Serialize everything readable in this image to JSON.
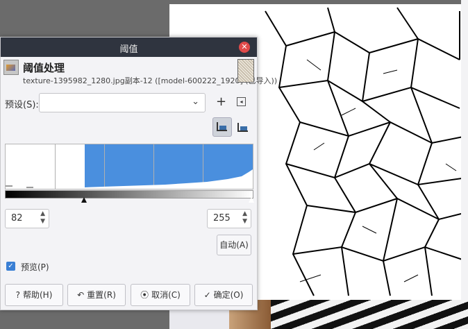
{
  "dialog": {
    "window_title": "阈值",
    "heading": "阈值处理",
    "subtitle": "texture-1395982_1280.jpg副本-12 ([model-600222_1920] (已导入))",
    "preset_label": "预设(S):",
    "preset_value": "",
    "add_symbol": "+",
    "menu_symbol": "◂",
    "histogram": {
      "low": 82,
      "high": 255,
      "range_max": 255
    },
    "low_value": "82",
    "high_value": "255",
    "auto_label": "自动(A)",
    "preview_label": "预览(P)",
    "preview_checked": true,
    "buttons": {
      "help": "帮助(H)",
      "reset": "重置(R)",
      "cancel": "取消(C)",
      "ok": "确定(O)"
    },
    "icons": {
      "help": "?",
      "ok": "✓"
    }
  },
  "colors": {
    "titlebar": "#2f343f",
    "selection": "#4a8fde",
    "close": "#e04a4a"
  }
}
